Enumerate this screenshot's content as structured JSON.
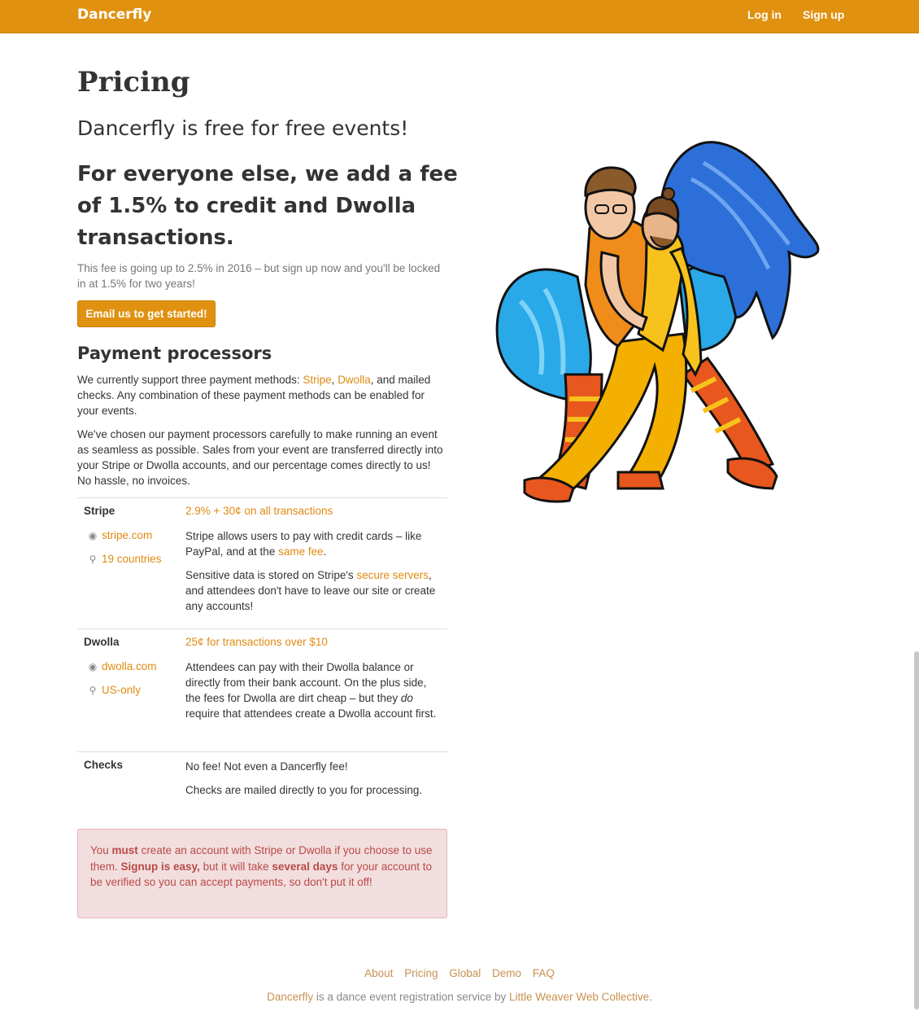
{
  "nav": {
    "brand": "Dancerfly",
    "login": "Log in",
    "signup": "Sign up"
  },
  "main": {
    "title": "Pricing",
    "lead1": "Dancerfly is free for free events!",
    "lead2_pre": "For everyone else, we add a fee of",
    "lead2_rate": "1.5%",
    "lead2_post": "to credit and Dwolla transactions.",
    "note": "This fee is going up to 2.5% in 2016 – but sign up now and you'll be locked in at 1.5% for two years!",
    "cta": "Email us to get started!"
  },
  "processors_section": {
    "title": "Payment processors",
    "p1_pre": "We currently support three payment methods: ",
    "p1_stripe": "Stripe",
    "p1_comma": ", ",
    "p1_dwolla": "Dwolla",
    "p1_post": ", and mailed checks. Any combination of these payment methods can be enabled for your events.",
    "p2": "We've chosen our payment processors carefully to make running an event as seamless as possible. Sales from your event are transferred directly into your Stripe or Dwolla accounts, and our percentage comes directly to us! No hassle, no invoices."
  },
  "stripe": {
    "name": "Stripe",
    "fee": "2.9% + 30¢ on all transactions",
    "site": "stripe.com",
    "coverage": "19 countries",
    "desc1_pre": "Stripe allows users to pay with credit cards – like PayPal, and at the ",
    "desc1_link": "same fee",
    "desc1_post": ".",
    "desc2_pre": "Sensitive data is stored on Stripe's ",
    "desc2_link": "secure servers",
    "desc2_post": ", and attendees don't have to leave our site or create any accounts!"
  },
  "dwolla": {
    "name": "Dwolla",
    "fee": "25¢ for transactions over $10",
    "site": "dwolla.com",
    "coverage": "US-only",
    "desc_pre": "Attendees can pay with their Dwolla balance or directly from their bank account. On the plus side, the fees for Dwolla are dirt cheap – but they ",
    "desc_em": "do",
    "desc_post": " require that attendees create a Dwolla account first."
  },
  "checks": {
    "name": "Checks",
    "desc1": "No fee! Not even a Dancerfly fee!",
    "desc2": "Checks are mailed directly to you for processing."
  },
  "alert": {
    "a1": "You ",
    "a2": "must",
    "a3": " create an account with Stripe or Dwolla if you choose to use them. ",
    "a4": "Signup is easy,",
    "a5": " but it will take ",
    "a6": "several days",
    "a7": " for your account to be verified so you can accept payments, so don't put it off!"
  },
  "footer": {
    "links": [
      "About",
      "Pricing",
      "Global",
      "Demo",
      "FAQ"
    ],
    "brand": "Dancerfly",
    "text_mid": " is a dance event registration service by ",
    "collective": "Little Weaver Web Collective",
    "text_end": "."
  },
  "colors": {
    "accent": "#e0910f",
    "link": "#e08a12",
    "alert_bg": "#f2dede",
    "alert_text": "#b94a48"
  },
  "icons": {
    "site": "globe-icon",
    "coverage": "map-marker-icon"
  }
}
